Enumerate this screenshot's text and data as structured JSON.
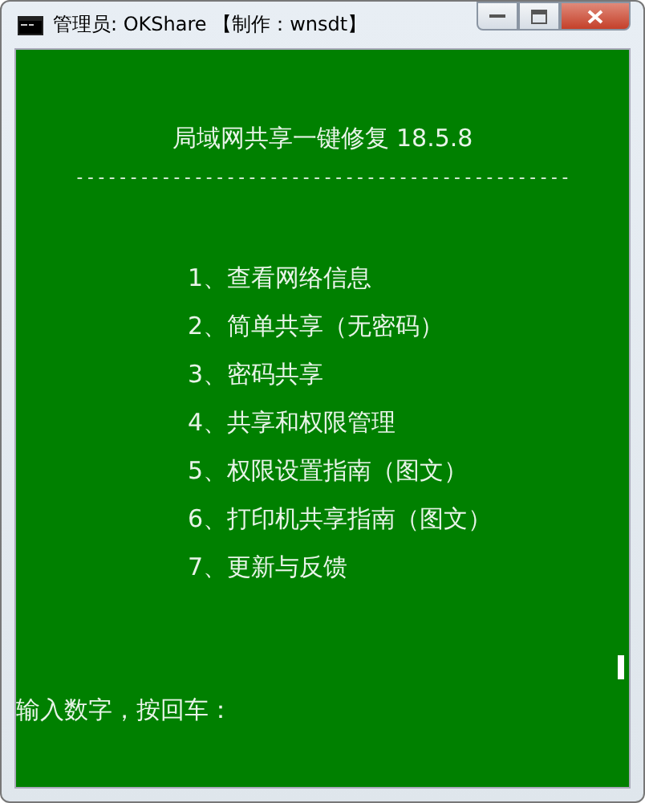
{
  "window": {
    "title": "管理员:  OKShare 【制作：wnsdt】"
  },
  "console": {
    "heading": "局域网共享一键修复 18.5.8",
    "separator": "----------------------------------------------",
    "menu": [
      "1、查看网络信息",
      "2、简单共享（无密码）",
      "3、密码共享",
      "4、共享和权限管理",
      "5、权限设置指南（图文）",
      "6、打印机共享指南（图文）",
      "7、更新与反馈"
    ],
    "prompt": "输入数字，按回车："
  }
}
